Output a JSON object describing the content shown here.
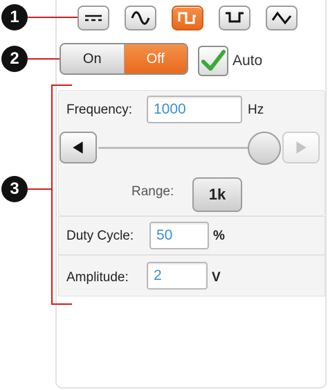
{
  "callouts": [
    "1",
    "2",
    "3"
  ],
  "waveforms": [
    {
      "name": "dc",
      "icon": "dc-wave-icon",
      "active": false
    },
    {
      "name": "sine",
      "icon": "sine-wave-icon",
      "active": false
    },
    {
      "name": "square",
      "icon": "square-wave-icon",
      "active": true
    },
    {
      "name": "pulse",
      "icon": "pulse-wave-icon",
      "active": false
    },
    {
      "name": "triangle",
      "icon": "triangle-wave-icon",
      "active": false
    }
  ],
  "power": {
    "on_label": "On",
    "off_label": "Off",
    "selected": "Off"
  },
  "auto": {
    "label": "Auto",
    "checked": true
  },
  "frequency": {
    "label": "Frequency:",
    "value": "1000",
    "unit": "Hz",
    "slider_level": 0.92
  },
  "range": {
    "label": "Range:",
    "value": "1k"
  },
  "duty_cycle": {
    "label": "Duty Cycle:",
    "value": "50",
    "unit": "%"
  },
  "amplitude": {
    "label": "Amplitude:",
    "value": "2",
    "unit": "V"
  },
  "colors": {
    "accent": "#E96A1D",
    "callout_line": "#D21E1E",
    "value_text": "#3C8FD0",
    "check": "#3AAA35"
  }
}
